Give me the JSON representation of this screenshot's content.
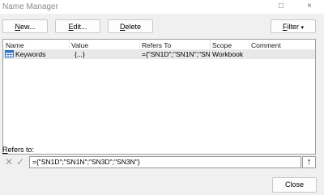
{
  "window": {
    "title": "Name Manager",
    "minimize_glyph": "□",
    "close_glyph": "×"
  },
  "toolbar": {
    "new_label_key": "N",
    "new_label_rest": "ew...",
    "edit_label_key": "E",
    "edit_label_rest": "dit...",
    "delete_label_key": "D",
    "delete_label_rest": "elete",
    "filter_label_key": "F",
    "filter_label_rest": "ilter",
    "filter_arrow": "▾"
  },
  "table": {
    "columns": [
      "Name",
      "Value",
      "Refers To",
      "Scope",
      "Comment"
    ],
    "rows": [
      {
        "name": "Keywords",
        "value": "{...}",
        "refers_to": "={\"SN1D\";\"SN1N\";\"SN...",
        "scope": "Workbook",
        "comment": ""
      }
    ]
  },
  "refers": {
    "label_key": "R",
    "label_rest": "efers to:",
    "value": "={\"SN1D\";\"SN1N\";\"SN3D\";\"SN3N\"}",
    "cancel_glyph": "✕",
    "confirm_glyph": "✓",
    "collapse_glyph": "↑"
  },
  "footer": {
    "close_label": "Close"
  },
  "colors": {
    "accent": "#2f6ec4",
    "selected_row": "#e8e8e8"
  }
}
